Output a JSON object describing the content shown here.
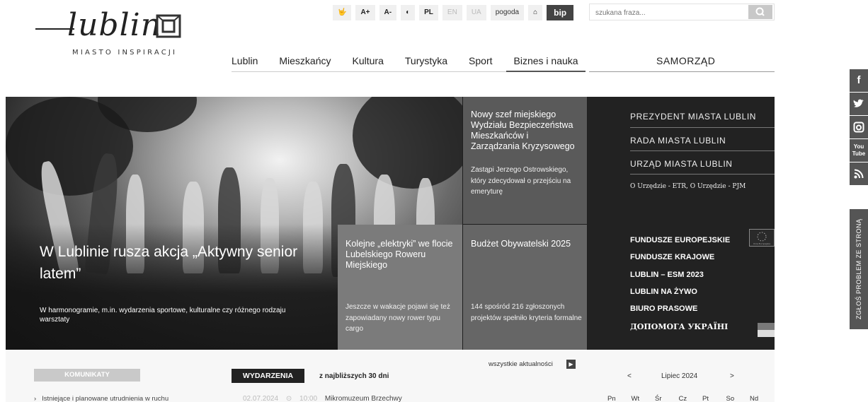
{
  "logo": {
    "wordmark": "lublin",
    "tagline": "MIASTO INSPIRACJI"
  },
  "toolbar": {
    "accessibility_icon": "sign-language-icon",
    "font_up": "A+",
    "font_down": "A-",
    "contrast_icon": "contrast-icon",
    "lang_pl": "PL",
    "lang_en": "EN",
    "lang_ua": "UA",
    "weather": "pogoda",
    "home_icon": "home-icon",
    "bip": "bip"
  },
  "search": {
    "placeholder": "szukana fraza...",
    "button_icon": "search-icon"
  },
  "nav": {
    "items": [
      "Lublin",
      "Mieszkańcy",
      "Kultura",
      "Turystyka",
      "Sport",
      "Biznes i nauka"
    ],
    "samorzad": "SAMORZĄD"
  },
  "social": {
    "facebook": "f",
    "twitter": "t",
    "instagram": "ig",
    "youtube_top": "You",
    "youtube_bottom": "Tube",
    "rss": "rss"
  },
  "report_tab": "ZGŁOŚ PROBLEM ZE STRONĄ",
  "hero": {
    "title": "W Lublinie rusza akcja „Aktywny senior latem”",
    "description": "W harmonogramie, m.in. wydarzenia sportowe, kulturalne czy różnego rodzaju warsztaty"
  },
  "tiles": [
    {
      "title": "Nowy szef miejskiego Wydziału Bezpieczeństwa Mieszkańców i Zarządzania Kryzysowego",
      "description": "Zastąpi Jerzego Ostrowskiego, który zdecydował o przejściu na emeryturę"
    },
    {
      "title": "Kolejne „elektryki” we flocie Lubelskiego Roweru Miejskiego",
      "description": "Jeszcze w wakacje pojawi się też zapowiadany nowy rower typu cargo"
    },
    {
      "title": "Budżet Obywatelski 2025",
      "description": "144 spośród 216 zgłoszonych projektów spełniło kryteria formalne"
    }
  ],
  "right_panel": {
    "links": [
      "PREZYDENT MIASTA LUBLIN",
      "RADA MIASTA LUBLIN",
      "URZĄD MIASTA LUBLIN"
    ],
    "small": "O Urzędzie - ETR, O Urzędzie - PJM",
    "bold_links": [
      "FUNDUSZE EUROPEJSKIE",
      "FUNDUSZE KRAJOWE",
      "LUBLIN – ESM 2023",
      "LUBLIN NA ŻYWO",
      "BIURO PRASOWE",
      "ДОПОМОГА УКРАЇНІ"
    ],
    "eu_caption": "Unia Europejska"
  },
  "bottom": {
    "komunikaty": "KOMUNIKATY",
    "komunikat_item": "Istniejące i planowane utrudnienia w ruchu",
    "wydarzenia": "WYDARZENIA",
    "wydarzenia_sub": "z najbliższych 30 dni",
    "all_news": "wszystkie aktualności",
    "event_date": "02.07.2024",
    "event_time": "10:00",
    "event_title": "Mikromuzeum Brzechwy",
    "calendar": {
      "prev": "<",
      "month": "Lipiec 2024",
      "next": ">",
      "days": [
        "Pn",
        "Wt",
        "Śr",
        "Cz",
        "Pt",
        "So",
        "Nd"
      ]
    }
  }
}
